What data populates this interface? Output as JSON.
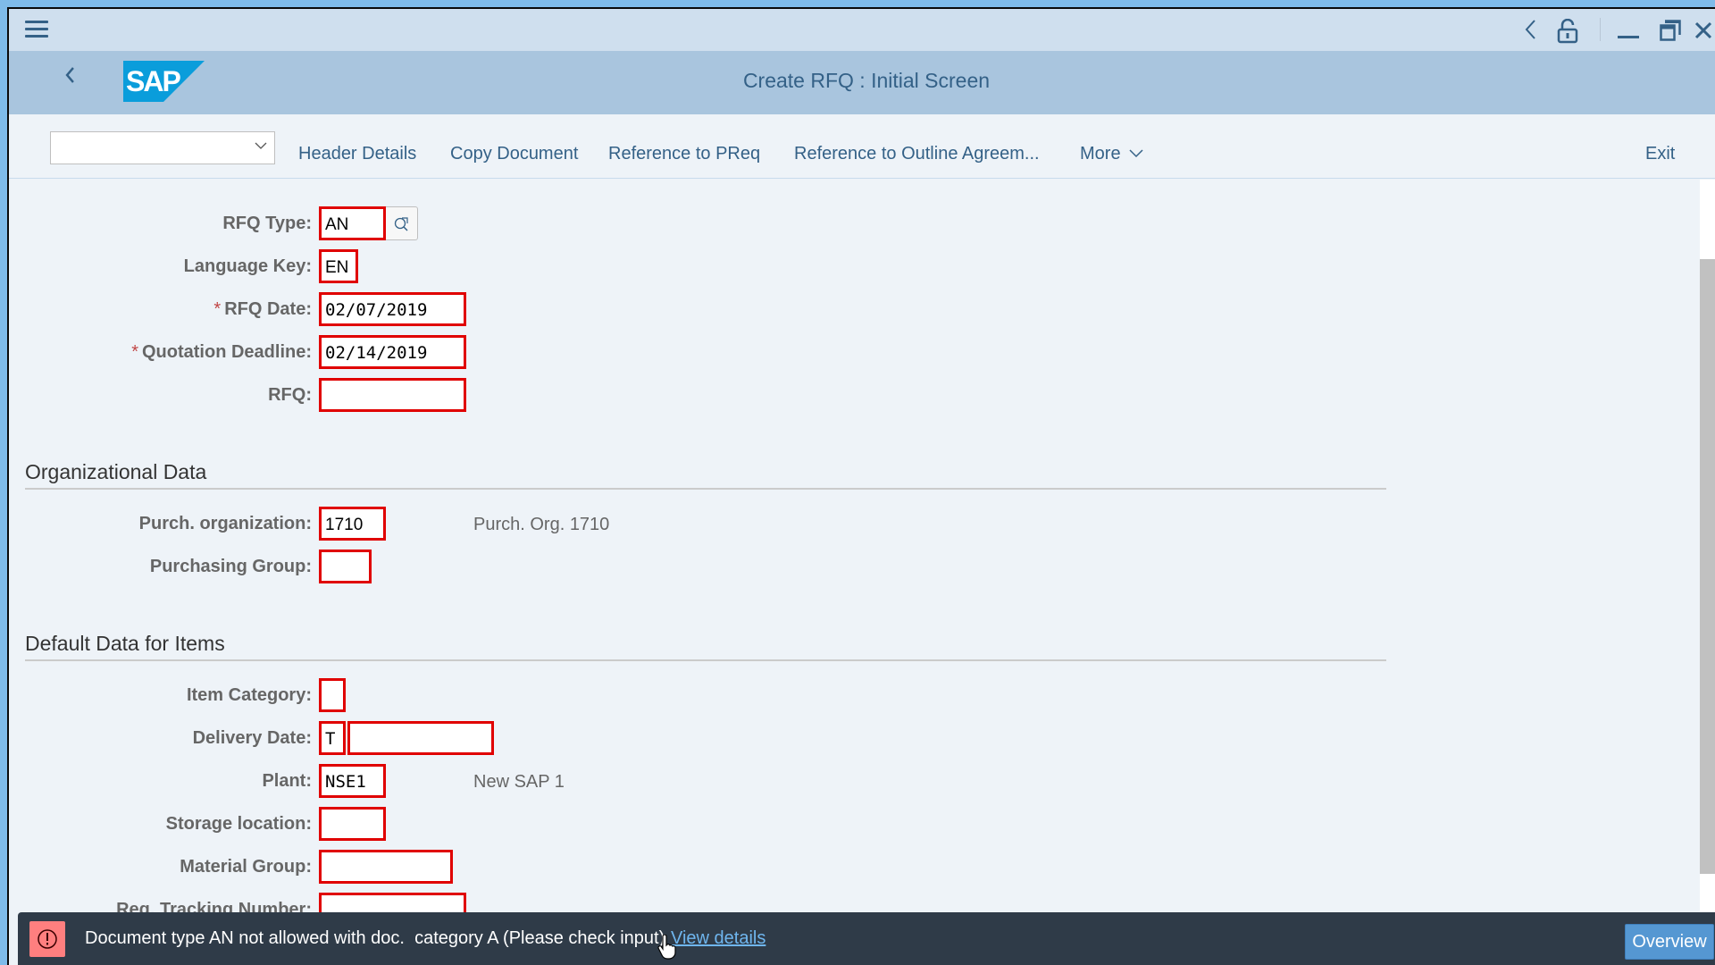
{
  "window": {
    "title_bar_icons": [
      "menu-icon",
      "back-icon",
      "lock-icon",
      "minimize-icon",
      "maximize-icon",
      "close-icon"
    ]
  },
  "header": {
    "logo_text": "SAP",
    "title": "Create RFQ : Initial Screen",
    "back_icon": "chevron-left-icon"
  },
  "toolbar": {
    "select_value": "",
    "buttons": [
      "Header Details",
      "Copy Document",
      "Reference to PReq",
      "Reference to Outline Agreem...",
      "More"
    ],
    "exit_label": "Exit"
  },
  "form": {
    "rfq_type": {
      "label": "RFQ Type:",
      "value": "AN"
    },
    "language_key": {
      "label": "Language Key:",
      "value": "EN"
    },
    "rfq_date": {
      "label": "RFQ Date:",
      "required": "*",
      "value": "02/07/2019"
    },
    "quotation_deadline": {
      "label": "Quotation Deadline:",
      "required": "*",
      "value": "02/14/2019"
    },
    "rfq": {
      "label": "RFQ:",
      "value": ""
    }
  },
  "org_data": {
    "title": "Organizational Data",
    "purch_org": {
      "label": "Purch. organization:",
      "value": "1710",
      "description": "Purch. Org. 1710"
    },
    "purch_group": {
      "label": "Purchasing Group:",
      "value": ""
    }
  },
  "default_data": {
    "title": "Default Data for Items",
    "item_category": {
      "label": "Item Category:",
      "value": ""
    },
    "delivery_date": {
      "label": "Delivery Date:",
      "format_value": "T",
      "value": ""
    },
    "plant": {
      "label": "Plant:",
      "value": "NSE1",
      "description": "New SAP 1"
    },
    "storage_location": {
      "label": "Storage location:",
      "value": ""
    },
    "material_group": {
      "label": "Material Group:",
      "value": ""
    },
    "req_tracking_number": {
      "label": "Req. Tracking Number:",
      "value": ""
    }
  },
  "message": {
    "type": "error",
    "text": "Document type AN not allowed with doc.  category A (Please check input)",
    "link": "View details",
    "overview_label": "Overview"
  },
  "colors": {
    "error_border": "#e00000",
    "header_bg": "#a9c5de",
    "accent_text": "#346187",
    "message_bg": "#2f3b48",
    "overview_btn": "#5597d2"
  }
}
